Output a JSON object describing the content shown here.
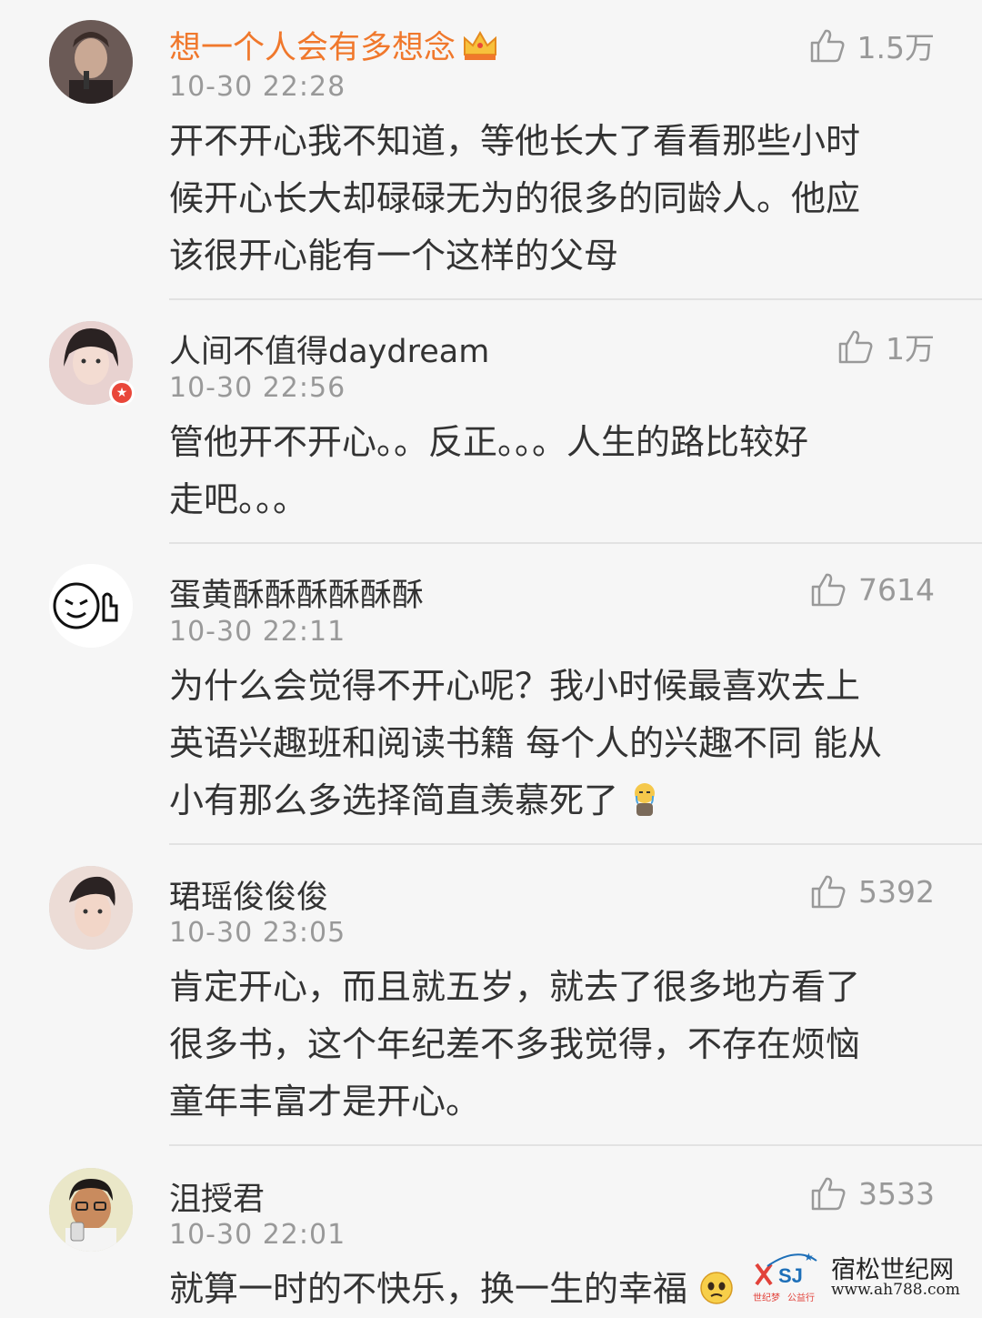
{
  "comments": [
    {
      "username": "想一个人会有多想念",
      "time": "10-30 22:28",
      "likes": "1.5万",
      "text_lines": [
        "开不开心我不知道，等他长大了看看那些小时",
        "候开心长大却碌碌无为的很多的同龄人。他应",
        "该很开心能有一个这样的父母"
      ]
    },
    {
      "username": "人间不值得daydream",
      "time": "10-30 22:56",
      "likes": "1万",
      "text_lines": [
        "管他开不开心。。反正。。。人生的路比较好",
        "走吧。。。"
      ]
    },
    {
      "username": "蛋黄酥酥酥酥酥酥",
      "time": "10-30 22:11",
      "likes": "7614",
      "text_lines": [
        "为什么会觉得不开心呢？我小时候最喜欢去上",
        "英语兴趣班和阅读书籍 每个人的兴趣不同 能从",
        "小有那么多选择简直羡慕死了"
      ]
    },
    {
      "username": "珺瑶俊俊俊",
      "time": "10-30 23:05",
      "likes": "5392",
      "text_lines": [
        "肯定开心，而且就五岁，就去了很多地方看了",
        "很多书，这个年纪差不多我觉得，不存在烦恼",
        "童年丰富才是开心。"
      ]
    },
    {
      "username": "沮授君",
      "time": "10-30 22:01",
      "likes": "3533",
      "text_lines": [
        "就算一时的不快乐，换一生的幸福"
      ]
    }
  ],
  "watermark": {
    "title": "宿松世纪网",
    "url": "www.ah788.com",
    "logo_small_left": "世纪梦",
    "logo_small_right": "公益行"
  },
  "icons": {
    "like": "thumbs-up-icon",
    "vip": "crown-icon",
    "verified": "verified-badge-icon"
  },
  "colors": {
    "background": "#f6f6f6",
    "vip_name": "#f0782c",
    "text": "#333333",
    "meta": "#999999"
  }
}
